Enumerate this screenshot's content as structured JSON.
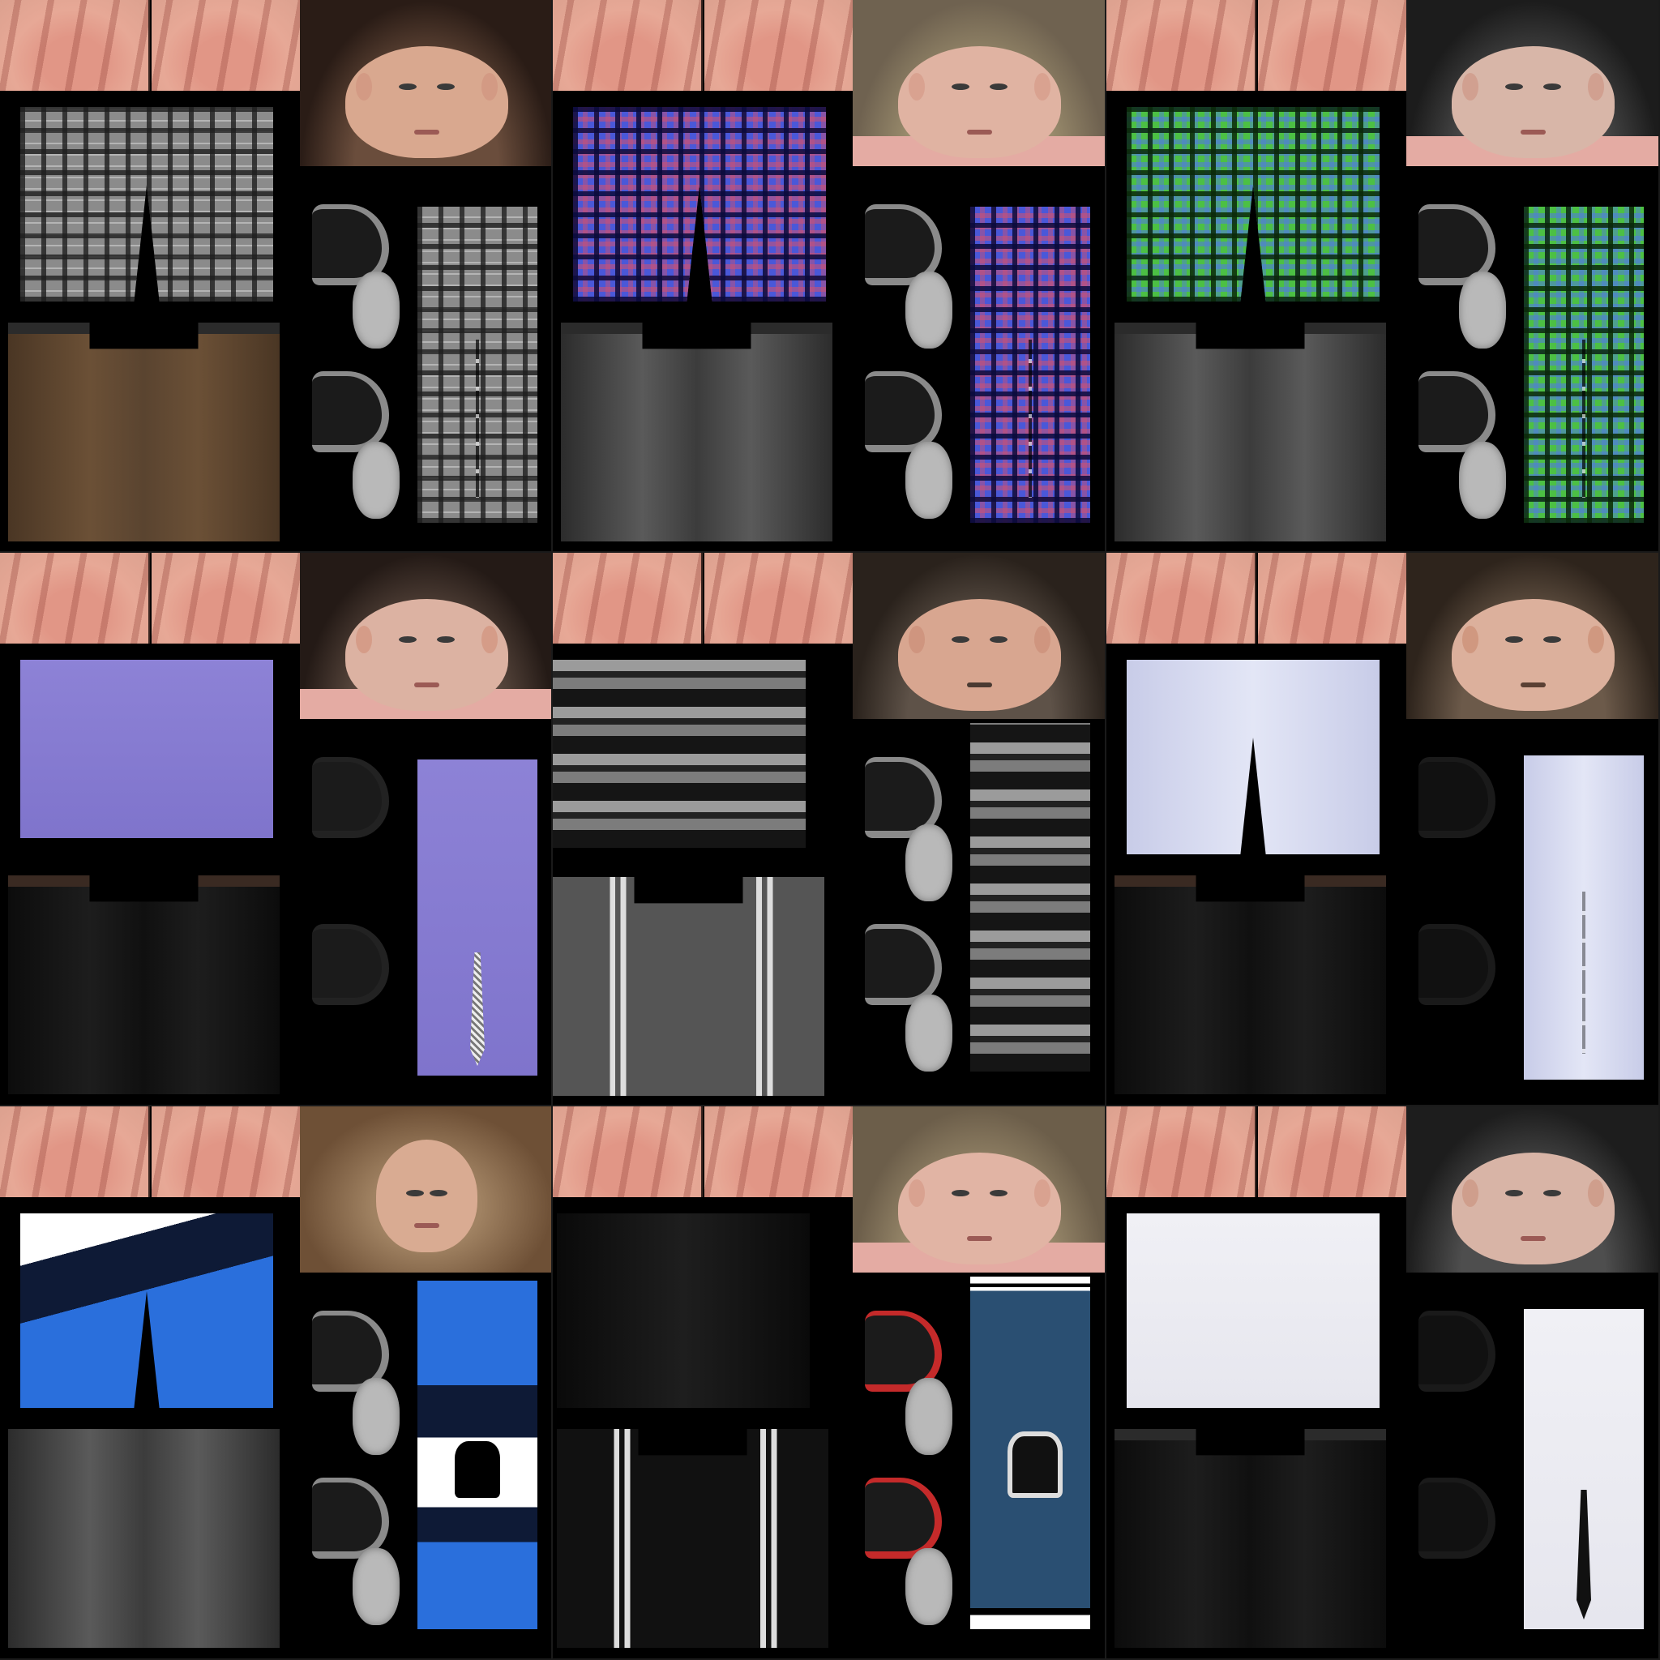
{
  "image": {
    "type": "character texture atlas",
    "grid": {
      "rows": 3,
      "cols": 3
    }
  },
  "tiles": [
    {
      "name": "tile-1",
      "hair": "dark-brown",
      "top": "grey-plaid-shirt",
      "pants": "brown-jeans",
      "tie": false
    },
    {
      "name": "tile-2",
      "hair": "blonde-grey",
      "top": "blue-red-plaid-shirt",
      "pants": "grey-jeans",
      "tie": false
    },
    {
      "name": "tile-3",
      "hair": "black",
      "top": "green-blue-plaid-shirt",
      "pants": "grey-jeans",
      "tie": false
    },
    {
      "name": "tile-4",
      "hair": "dark-brown",
      "top": "purple-shirt",
      "pants": "black-jeans",
      "tie": true
    },
    {
      "name": "tile-5",
      "hair": "dark-brown",
      "top": "black-grey-striped-shirt",
      "pants": "grey-track-pants",
      "tie": false
    },
    {
      "name": "tile-6",
      "hair": "dark-brown",
      "top": "light-blue-dress-shirt",
      "pants": "black-jeans",
      "tie": false
    },
    {
      "name": "tile-7",
      "hair": "brown-shaved",
      "top": "blue-navy-white-track-top",
      "pants": "dark-grey-jeans",
      "tie": false
    },
    {
      "name": "tile-8",
      "hair": "blonde-grey",
      "top": "blue-varsity-jacket",
      "pants": "black-track-pants",
      "tie": false
    },
    {
      "name": "tile-9",
      "hair": "black",
      "top": "white-dress-shirt",
      "pants": "black-jeans",
      "tie": true
    }
  ],
  "colors": {
    "background": "#000000",
    "skin": "#e4a898"
  }
}
